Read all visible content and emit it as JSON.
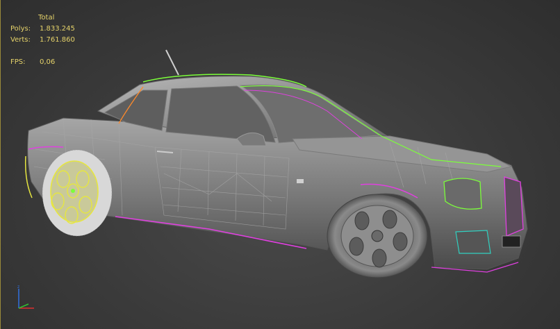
{
  "stats": {
    "total_label": "Total",
    "polys_label": "Polys:",
    "polys_value": "1.833.245",
    "verts_label": "Verts:",
    "verts_value": "1.761.860",
    "fps_label": "FPS:",
    "fps_value": "0,06"
  },
  "colors": {
    "stats_text": "#e6d36a",
    "viewport_bg": "#3b3b3b",
    "car_body": "#8c8c8c",
    "selection_green": "#7cff3a",
    "selection_magenta": "#e040e0",
    "selection_orange": "#ff8a2a",
    "selection_yellow": "#e6e640",
    "axis_x": "#e03030",
    "axis_y": "#30c030",
    "axis_z": "#3070e0"
  },
  "icons": {
    "axis_gizmo": "axis-tripod-icon",
    "model": "car-wireframe"
  }
}
